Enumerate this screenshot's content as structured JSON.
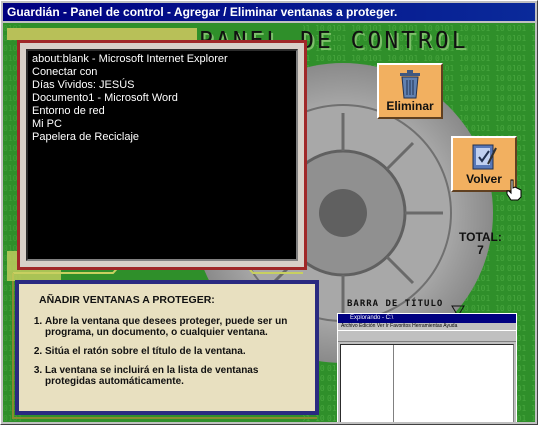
{
  "window": {
    "title": "Guardián - Panel de control - Agregar / Eliminar ventanas a proteger."
  },
  "header": {
    "text": "PANEL DE CONTROL"
  },
  "window_list": {
    "items": [
      "about:blank - Microsoft Internet Explorer",
      "Conectar con",
      "Días Vividos: JESÚS",
      "Documento1 - Microsoft Word",
      "Entorno de red",
      "Mi PC",
      "Papelera de Reciclaje"
    ]
  },
  "buttons": {
    "eliminar": "Eliminar",
    "volver": "Volver"
  },
  "total": {
    "label": "TOTAL:",
    "value": "7"
  },
  "instructions": {
    "title": "AÑADIR VENTANAS A PROTEGER:",
    "steps": [
      "Abre la ventana que desees proteger, puede ser un programa, un documento, o cualquier ventana.",
      "Sitúa el ratón sobre el título de la ventana.",
      "La ventana se incluirá en la lista de ventanas protegidas automáticamente."
    ]
  },
  "preview": {
    "label": "BARRA DE TÍTULO",
    "window_title": "Explorando - C:\\",
    "menu": "Archivo  Edición  Ver  Ir  Favoritos  Herramientas  Ayuda"
  },
  "colors": {
    "background": "#2f8f2a",
    "button": "#f2b060",
    "title_bar": "#000080"
  }
}
